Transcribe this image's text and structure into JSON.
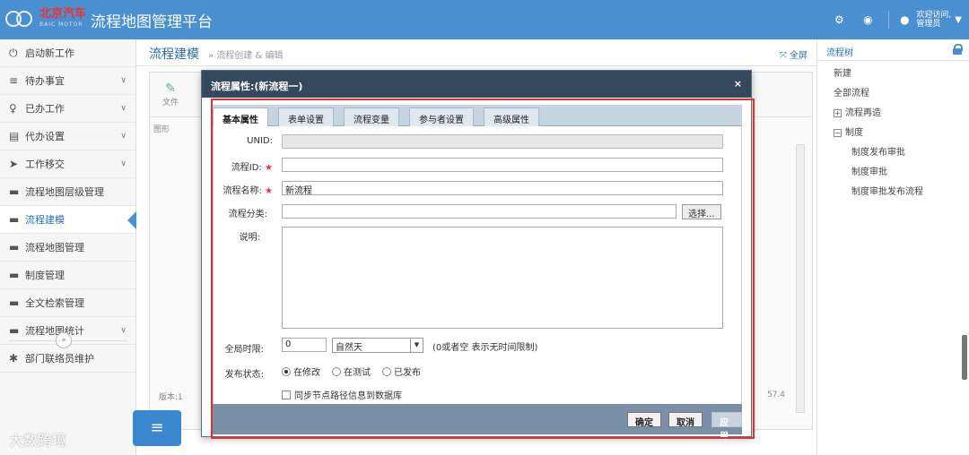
{
  "header": {
    "brand": "北京汽车",
    "brand_sub": "BAIC MOTOR",
    "app_title": "流程地图管理平台",
    "user_line1": "欢迎访问,",
    "user_line2": "管理员"
  },
  "sidebar": {
    "items": [
      {
        "label": "启动新工作"
      },
      {
        "label": "待办事宜"
      },
      {
        "label": "已办工作"
      },
      {
        "label": "代办设置"
      },
      {
        "label": "工作移交"
      },
      {
        "label": "流程地图层级管理"
      },
      {
        "label": "流程建模"
      },
      {
        "label": "流程地图管理"
      },
      {
        "label": "制度管理"
      },
      {
        "label": "全文检索管理"
      },
      {
        "label": "流程地图统计"
      },
      {
        "label": "部门联络员维护"
      }
    ]
  },
  "watermark": "大数跨境",
  "page": {
    "title": "流程建模",
    "breadcrumb": "» 流程创建 & 编辑",
    "fullscreen": "全屏"
  },
  "workspace": {
    "file_label": "文件",
    "tab_hint": "图形",
    "version": "版本:1",
    "zoom": "57.4"
  },
  "right_panel": {
    "title": "流程树",
    "items": [
      {
        "label": "新建"
      },
      {
        "label": "全部流程"
      },
      {
        "label": "流程再造",
        "toggle": "+"
      },
      {
        "label": "制度",
        "toggle": "−"
      },
      {
        "label": "制度发布审批"
      },
      {
        "label": "制度审批"
      },
      {
        "label": "制度审批发布流程"
      }
    ]
  },
  "dialog": {
    "title": "流程属性:(新流程一)",
    "close": "×",
    "tabs": [
      "基本属性",
      "表单设置",
      "流程变量",
      "参与者设置",
      "高级属性"
    ],
    "fields": {
      "unid_label": "UNID:",
      "unid_value": "",
      "id_label": "流程ID:",
      "id_value": "",
      "name_label": "流程名称:",
      "name_value": "新流程",
      "category_label": "流程分类:",
      "category_value": "",
      "select_btn": "选择...",
      "desc_label": "说明:",
      "limit_label": "全局时限:",
      "limit_value": "0",
      "limit_unit": "自然天",
      "limit_hint": "(0或者空 表示无时间限制)",
      "status_label": "发布状态:",
      "status_options": [
        "在修改",
        "在测试",
        "已发布"
      ],
      "status_selected": "在修改",
      "sync_label": "同步节点路径信息到数据库"
    },
    "buttons": {
      "ok": "确定",
      "cancel": "取消",
      "apply": "应用"
    }
  },
  "colors": {
    "header_bg": "#4a8fd0",
    "dialog_title_bg": "#34495e",
    "highlight": "#e03030"
  }
}
